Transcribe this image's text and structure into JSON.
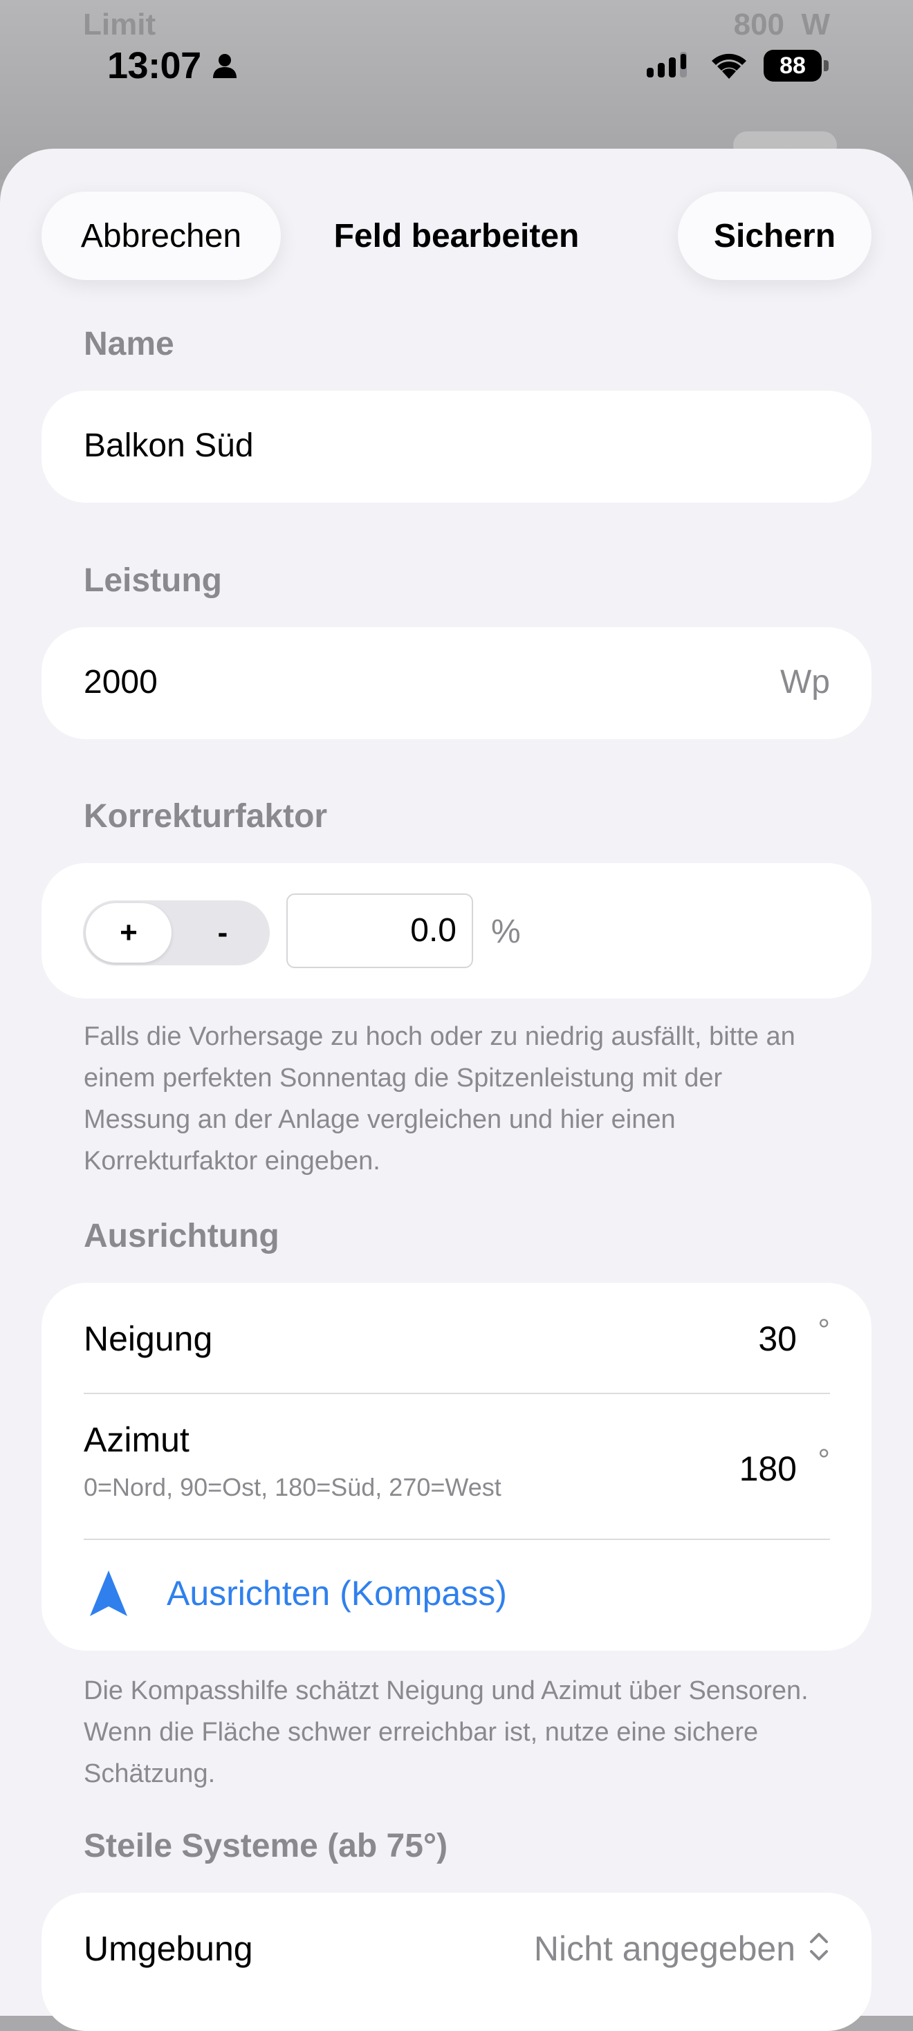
{
  "background": {
    "ghost_left": "Limit",
    "ghost_value": "800",
    "ghost_unit": "W"
  },
  "status_bar": {
    "time": "13:07",
    "battery": "88"
  },
  "nav": {
    "cancel_label": "Abbrechen",
    "title": "Feld bearbeiten",
    "save_label": "Sichern"
  },
  "name_section": {
    "header": "Name",
    "value": "Balkon Süd"
  },
  "power_section": {
    "header": "Leistung",
    "value": "2000",
    "unit": "Wp"
  },
  "correction_section": {
    "header": "Korrekturfaktor",
    "plus_label": "+",
    "minus_label": "-",
    "value": "0.0",
    "unit": "%",
    "footnote": "Falls die Vorhersage zu hoch oder zu niedrig ausfällt, bitte an einem perfekten Sonnentag die Spitzenleistung mit der Messung an der Anlage vergleichen und hier einen Korrekturfaktor eingeben."
  },
  "orientation_section": {
    "header": "Ausrichtung",
    "tilt_label": "Neigung",
    "tilt_value": "30",
    "tilt_unit": "°",
    "azimuth_label": "Azimut",
    "azimuth_hint": "0=Nord, 90=Ost, 180=Süd, 270=West",
    "azimuth_value": "180",
    "azimuth_unit": "°",
    "compass_label": "Ausrichten (Kompass)",
    "footnote": "Die Kompasshilfe schätzt Neigung und Azimut über Sensoren. Wenn die Fläche schwer erreichbar ist, nutze eine sichere Schätzung."
  },
  "steep_section": {
    "header": "Steile Systeme (ab 75°)",
    "environment_label": "Umgebung",
    "environment_value": "Nicht angegeben"
  },
  "colors": {
    "accent": "#2f80ed",
    "sheet_background": "#f2f2f7",
    "secondary_text": "#8a8a8e"
  },
  "icons": [
    "person-icon",
    "cellular-signal-icon",
    "wifi-icon",
    "battery-icon",
    "compass-arrow-icon",
    "chevron-up-down-icon"
  ]
}
